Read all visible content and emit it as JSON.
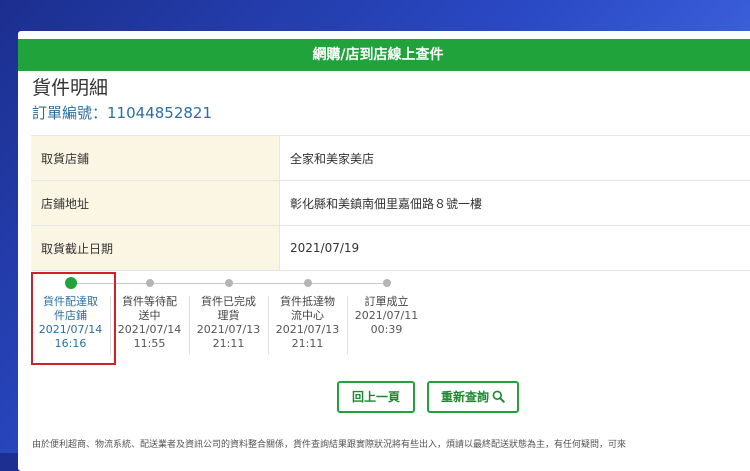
{
  "header": {
    "title": "網購/店到店線上查件"
  },
  "page_title": "貨件明細",
  "order": {
    "label": "訂單編號：",
    "number": "11044852821"
  },
  "info_rows": [
    {
      "label": "取貨店鋪",
      "value": "全家和美家美店"
    },
    {
      "label": "店鋪地址",
      "value": "彰化縣和美鎮南佃里嘉佃路８號一樓"
    },
    {
      "label": "取貨截止日期",
      "value": "2021/07/19"
    }
  ],
  "timeline": [
    {
      "status": "貨件配達取件店鋪",
      "date": "2021/07/14",
      "time": "16:16",
      "active": true
    },
    {
      "status": "貨件等待配送中",
      "date": "2021/07/14",
      "time": "11:55"
    },
    {
      "status": "貨件已完成理貨",
      "date": "2021/07/13",
      "time": "21:11"
    },
    {
      "status": "貨件抵達物流中心",
      "date": "2021/07/13",
      "time": "21:11"
    },
    {
      "status": "訂單成立",
      "date": "2021/07/11",
      "time": "00:39"
    }
  ],
  "buttons": {
    "back": "回上一頁",
    "query": "重新查詢"
  },
  "footer": "由於便利超商、物流系統、配送業者及資訊公司的資料整合關係，貨件查詢結果跟實際狀況將有些出入，煩請以最終配送狀態為主，有任何疑問，可來",
  "colors": {
    "accent": "#1fa33a",
    "link": "#2b6fa0",
    "highlight": "#d0202a"
  }
}
